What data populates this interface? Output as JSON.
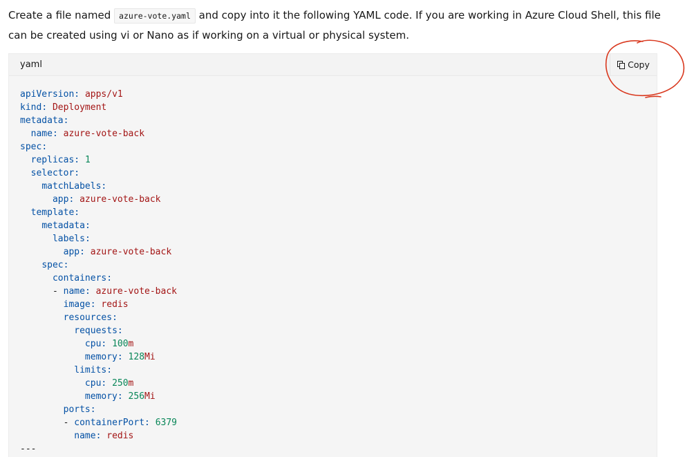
{
  "intro": {
    "before": "Create a file named ",
    "filename": "azure-vote.yaml",
    "after": " and copy into it the following YAML code. If you are working in Azure Cloud Shell, this file can be created using vi or Nano as if working on a virtual or physical system."
  },
  "code_block": {
    "language": "yaml",
    "copy_label": "Copy",
    "lines": [
      {
        "indent": 0,
        "dash": false,
        "key": "apiVersion",
        "value": "apps/v1"
      },
      {
        "indent": 0,
        "dash": false,
        "key": "kind",
        "value": "Deployment"
      },
      {
        "indent": 0,
        "dash": false,
        "key": "metadata",
        "value": ""
      },
      {
        "indent": 1,
        "dash": false,
        "key": "name",
        "value": "azure-vote-back"
      },
      {
        "indent": 0,
        "dash": false,
        "key": "spec",
        "value": ""
      },
      {
        "indent": 1,
        "dash": false,
        "key": "replicas",
        "value": "1",
        "num": true
      },
      {
        "indent": 1,
        "dash": false,
        "key": "selector",
        "value": ""
      },
      {
        "indent": 2,
        "dash": false,
        "key": "matchLabels",
        "value": ""
      },
      {
        "indent": 3,
        "dash": false,
        "key": "app",
        "value": "azure-vote-back"
      },
      {
        "indent": 1,
        "dash": false,
        "key": "template",
        "value": ""
      },
      {
        "indent": 2,
        "dash": false,
        "key": "metadata",
        "value": ""
      },
      {
        "indent": 3,
        "dash": false,
        "key": "labels",
        "value": ""
      },
      {
        "indent": 4,
        "dash": false,
        "key": "app",
        "value": "azure-vote-back"
      },
      {
        "indent": 2,
        "dash": false,
        "key": "spec",
        "value": ""
      },
      {
        "indent": 3,
        "dash": false,
        "key": "containers",
        "value": ""
      },
      {
        "indent": 3,
        "dash": true,
        "key": "name",
        "value": "azure-vote-back"
      },
      {
        "indent": 4,
        "dash": false,
        "key": "image",
        "value": "redis"
      },
      {
        "indent": 4,
        "dash": false,
        "key": "resources",
        "value": ""
      },
      {
        "indent": 5,
        "dash": false,
        "key": "requests",
        "value": ""
      },
      {
        "indent": 6,
        "dash": false,
        "key": "cpu",
        "value": "100",
        "num": true,
        "unit": "m"
      },
      {
        "indent": 6,
        "dash": false,
        "key": "memory",
        "value": "128",
        "num": true,
        "unit": "Mi"
      },
      {
        "indent": 5,
        "dash": false,
        "key": "limits",
        "value": ""
      },
      {
        "indent": 6,
        "dash": false,
        "key": "cpu",
        "value": "250",
        "num": true,
        "unit": "m"
      },
      {
        "indent": 6,
        "dash": false,
        "key": "memory",
        "value": "256",
        "num": true,
        "unit": "Mi"
      },
      {
        "indent": 4,
        "dash": false,
        "key": "ports",
        "value": ""
      },
      {
        "indent": 4,
        "dash": true,
        "key": "containerPort",
        "value": "6379",
        "num": true
      },
      {
        "indent": 5,
        "dash": false,
        "key": "name",
        "value": "redis"
      },
      {
        "indent": 0,
        "dash": false,
        "key": "",
        "value": "---",
        "sep": true
      }
    ]
  },
  "colors": {
    "key": "#0451a5",
    "string": "#a31515",
    "number": "#098658",
    "annotation": "#d9381e"
  },
  "icons": {
    "copy": "copy-icon",
    "annotation": "hand-drawn-circle"
  }
}
